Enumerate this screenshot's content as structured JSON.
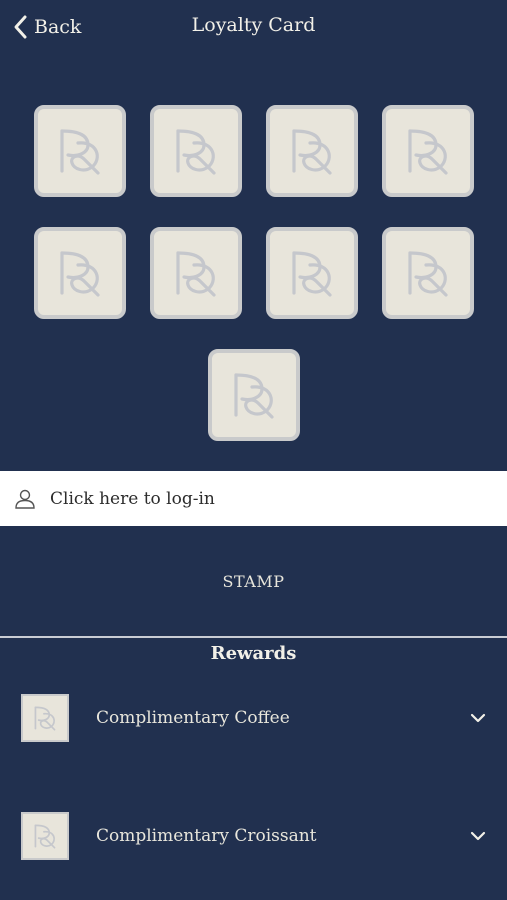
{
  "header": {
    "back_label": "Back",
    "title": "Loyalty Card"
  },
  "stamps": {
    "total": 9,
    "logo": "PD"
  },
  "login": {
    "label": "Click here to log-in",
    "icon": "user-icon"
  },
  "stamp_button": {
    "label": "STAMP"
  },
  "rewards": {
    "title": "Rewards",
    "items": [
      {
        "label": "Complimentary Coffee",
        "icon": "chevron-down-icon"
      },
      {
        "label": "Complimentary Croissant",
        "icon": "chevron-down-icon"
      }
    ]
  },
  "colors": {
    "background": "#21304f",
    "stamp_fill": "#e8e5db",
    "stamp_border": "#c9cacb",
    "login_bar": "#ffffff"
  }
}
